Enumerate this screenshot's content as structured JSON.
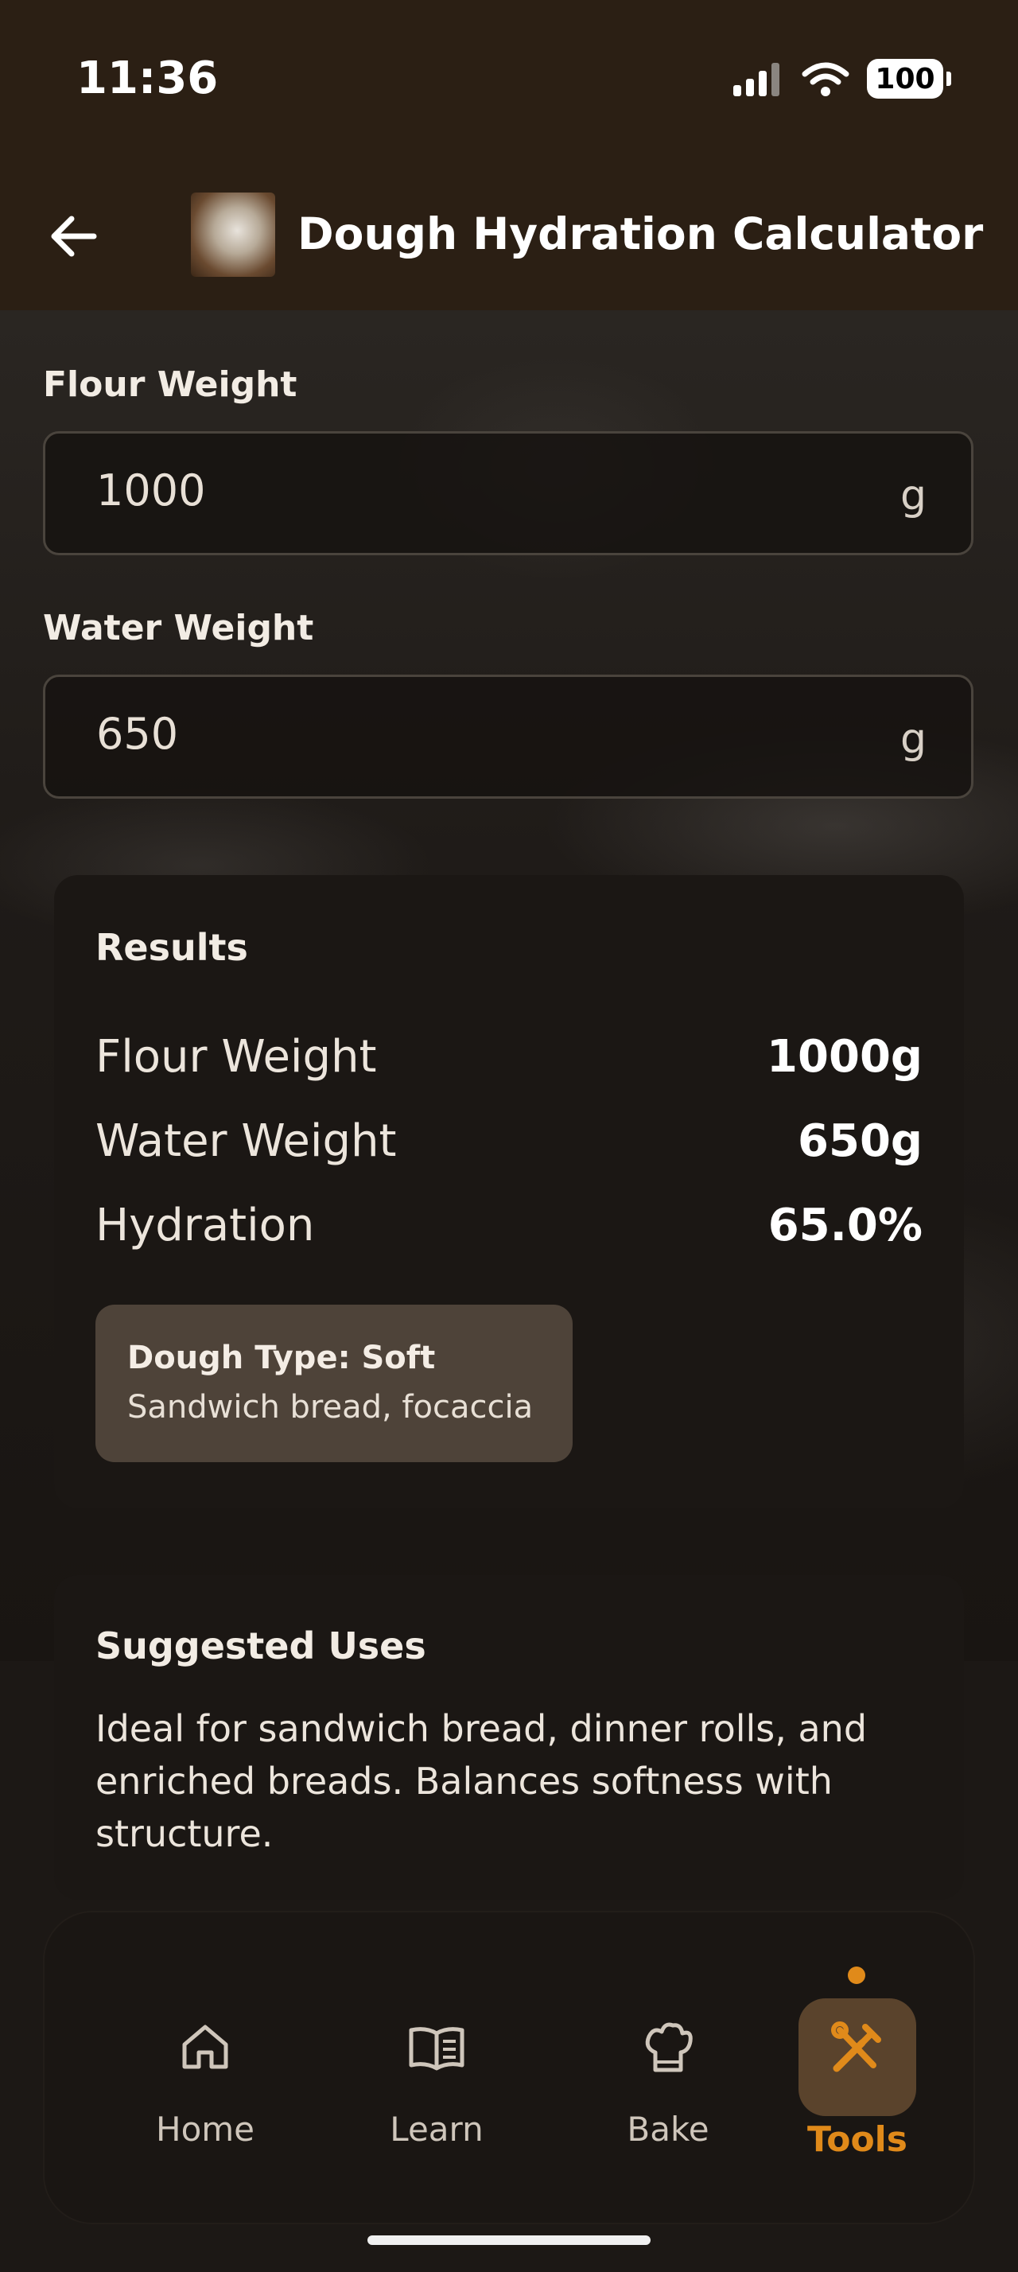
{
  "status": {
    "time": "11:36",
    "battery": "100"
  },
  "header": {
    "title": "Dough Hydration Calculator"
  },
  "inputs": {
    "flour": {
      "label": "Flour Weight",
      "value": "1000",
      "unit": "g"
    },
    "water": {
      "label": "Water Weight",
      "value": "650",
      "unit": "g"
    }
  },
  "results": {
    "title": "Results",
    "rows": [
      {
        "label": "Flour Weight",
        "value": "1000g"
      },
      {
        "label": "Water Weight",
        "value": "650g"
      },
      {
        "label": "Hydration",
        "value": "65.0%"
      }
    ],
    "dough_type": {
      "title": "Dough Type: Soft",
      "subtitle": "Sandwich bread, focaccia"
    }
  },
  "suggested": {
    "title": "Suggested Uses",
    "text": "Ideal for sandwich bread, dinner rolls, and enriched breads. Balances softness with structure."
  },
  "nav": {
    "items": [
      {
        "label": "Home",
        "icon": "home-icon"
      },
      {
        "label": "Learn",
        "icon": "book-icon"
      },
      {
        "label": "Bake",
        "icon": "chef-hat-icon"
      },
      {
        "label": "Tools",
        "icon": "tools-icon"
      }
    ],
    "active_color": "#e08a1a"
  }
}
